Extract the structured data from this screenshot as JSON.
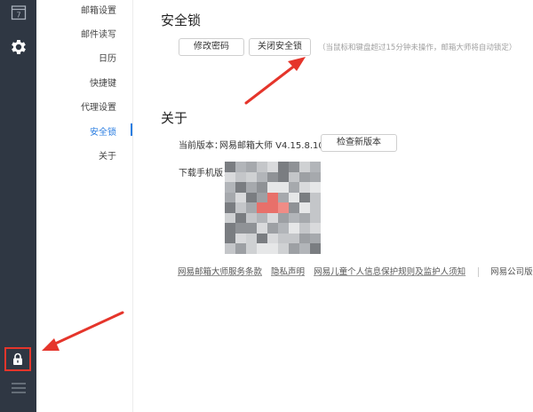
{
  "sidebar": {
    "calendar_day": "7",
    "icons": [
      "calendar-icon",
      "gear-icon",
      "lock-icon",
      "menu-icon"
    ]
  },
  "settings_nav": {
    "items": [
      {
        "label": "邮箱设置"
      },
      {
        "label": "邮件读写"
      },
      {
        "label": "日历"
      },
      {
        "label": "快捷键"
      },
      {
        "label": "代理设置"
      },
      {
        "label": "安全锁"
      },
      {
        "label": "关于"
      }
    ],
    "active": "安全锁"
  },
  "security_lock": {
    "title": "安全锁",
    "change_password_label": "修改密码",
    "disable_lock_label": "关闭安全锁",
    "hint": "（当鼠标和键盘超过15分钟未操作，邮箱大师将自动锁定）"
  },
  "about": {
    "title": "关于",
    "version_label": "当前版本：",
    "version_value": "网易邮箱大师 V4.15.8.1002",
    "check_update_label": "检查新版本",
    "mobile_download_label": "下载手机版：",
    "footer_links": [
      "网易邮箱大师服务条款",
      "隐私声明",
      "网易儿童个人信息保护规则及监护人须知"
    ],
    "copyright": "网易公司版权所"
  },
  "colors": {
    "sidebar_bg": "#2f3743",
    "accent": "#2a7de1",
    "annotation_red": "#e5352b"
  }
}
